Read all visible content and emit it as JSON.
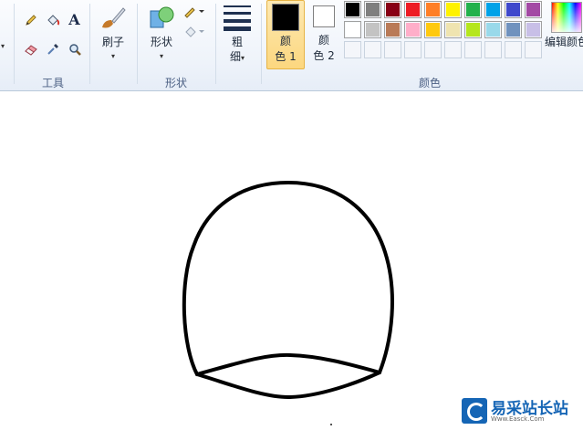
{
  "ribbon": {
    "tools": {
      "group_label": "工具",
      "items": [
        {
          "name": "pencil-icon"
        },
        {
          "name": "fill-bucket-icon"
        },
        {
          "name": "text-icon",
          "glyph": "A"
        },
        {
          "name": "eraser-icon"
        },
        {
          "name": "color-picker-icon"
        },
        {
          "name": "magnifier-icon"
        }
      ]
    },
    "brushes": {
      "label": "刷子",
      "caret": "▾"
    },
    "shapes": {
      "label": "形状",
      "caret": "▾",
      "group_label": "形状"
    },
    "size": {
      "label_1": "粗",
      "label_2": "细",
      "caret": "▾"
    },
    "colors": {
      "group_label": "颜色",
      "color1": {
        "label_1": "颜",
        "label_2": "色 1",
        "value": "#000000"
      },
      "color2": {
        "label_1": "颜",
        "label_2": "色 2",
        "value": "#ffffff"
      },
      "palette_row1": [
        "#000000",
        "#7f7f7f",
        "#880015",
        "#ed1c24",
        "#ff7f27",
        "#fff200",
        "#22b14c",
        "#00a2e8",
        "#3f48cc",
        "#a349a4"
      ],
      "palette_row2": [
        "#ffffff",
        "#c3c3c3",
        "#b97a57",
        "#ffaec9",
        "#ffc90e",
        "#efe4b0",
        "#b5e61d",
        "#99d9ea",
        "#7092be",
        "#c8bfe7"
      ],
      "edit_colors": "编辑颜色"
    }
  },
  "watermark": {
    "text": "易采站长站",
    "subtext": "Www.Easck.Com"
  }
}
